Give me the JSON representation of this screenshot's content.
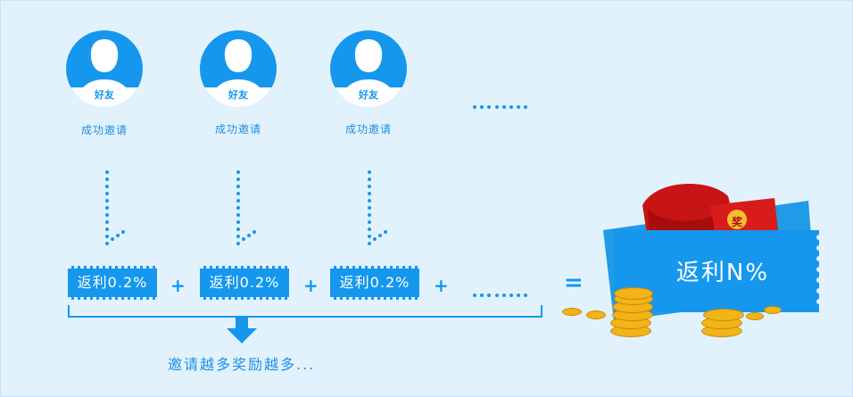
{
  "friends": [
    {
      "tag": "好友",
      "status": "成功邀请"
    },
    {
      "tag": "好友",
      "status": "成功邀请"
    },
    {
      "tag": "好友",
      "status": "成功邀请"
    }
  ],
  "rebates": [
    "返利0.2%",
    "返利0.2%",
    "返利0.2%"
  ],
  "operators": {
    "plus": "+",
    "equals": "="
  },
  "result": {
    "label": "返利N%",
    "envelope_badge": "奖"
  },
  "slogan": "邀请越多奖励越多...",
  "colors": {
    "accent": "#1597ee",
    "background": "#e2f2fd",
    "envelope": "#c71414",
    "coin": "#f2b417"
  }
}
